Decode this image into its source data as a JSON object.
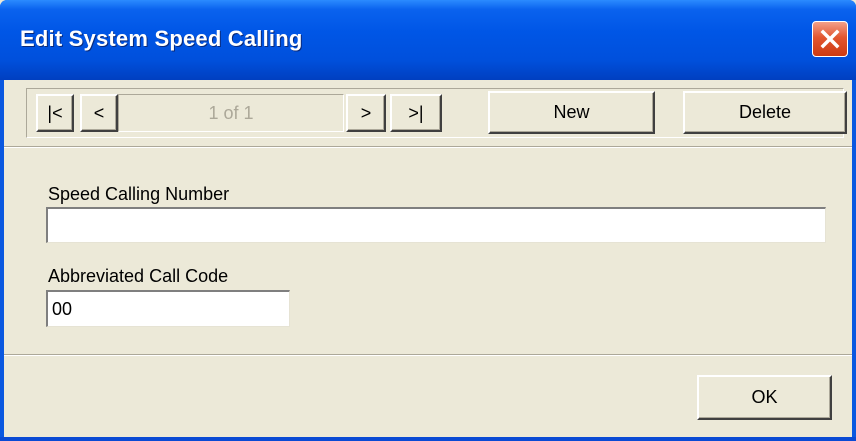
{
  "window": {
    "title": "Edit System Speed Calling"
  },
  "navigator": {
    "first_label": "|<",
    "prev_label": "<",
    "position_text": "1 of 1",
    "next_label": ">",
    "last_label": ">|",
    "new_label": "New",
    "delete_label": "Delete"
  },
  "form": {
    "speed_calling_number": {
      "label": "Speed Calling Number",
      "value": ""
    },
    "abbreviated_call_code": {
      "label": "Abbreviated Call Code",
      "value": "00"
    }
  },
  "footer": {
    "ok_label": "OK"
  },
  "colors": {
    "titlebar": "#0054e3",
    "dialog_bg": "#ece9d8",
    "close_button": "#d9461e"
  },
  "icons": {
    "close": "close-icon"
  }
}
